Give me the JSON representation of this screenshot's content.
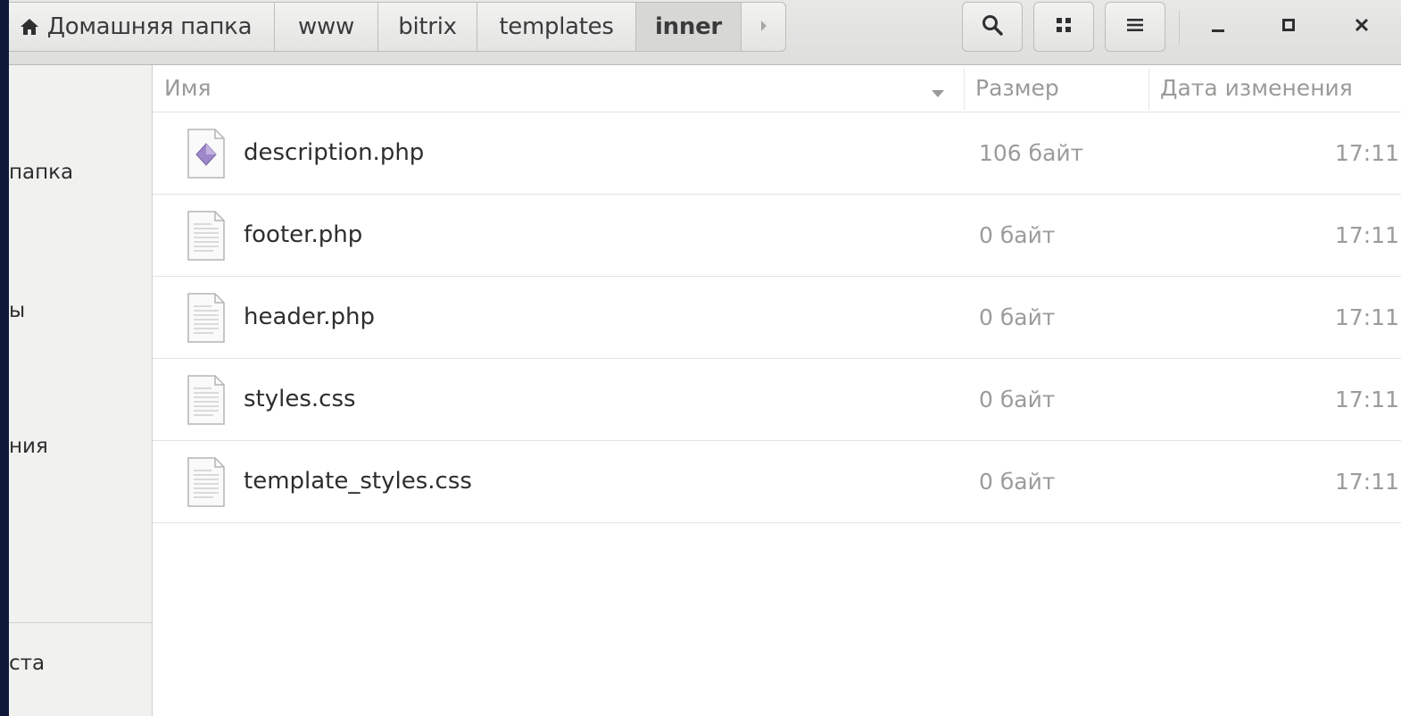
{
  "pathbar": {
    "crumbs": [
      "Домашняя папка",
      "www",
      "bitrix",
      "templates",
      "inner"
    ],
    "home_icon": "home-icon",
    "forward_icon": "chevron-right-icon"
  },
  "toolbar": {
    "search_icon": "search-icon",
    "view_icon": "grid-view-icon",
    "menu_icon": "hamburger-menu-icon"
  },
  "window_controls": {
    "minimize_glyph": "_",
    "maximize_icon": "maximize-icon",
    "close_glyph": "×"
  },
  "sidebar": {
    "items": [
      "папка",
      "ы",
      "ния",
      "ста"
    ]
  },
  "columns": {
    "name": "Имя",
    "size": "Размер",
    "modified": "Дата изменения"
  },
  "files": [
    {
      "name": "description.php",
      "size": "106 байт",
      "modified": "17:11",
      "icon": "php-file-icon"
    },
    {
      "name": "footer.php",
      "size": "0 байт",
      "modified": "17:11",
      "icon": "text-file-icon"
    },
    {
      "name": "header.php",
      "size": "0 байт",
      "modified": "17:11",
      "icon": "text-file-icon"
    },
    {
      "name": "styles.css",
      "size": "0 байт",
      "modified": "17:11",
      "icon": "text-file-icon"
    },
    {
      "name": "template_styles.css",
      "size": "0 байт",
      "modified": "17:11",
      "icon": "text-file-icon"
    }
  ]
}
